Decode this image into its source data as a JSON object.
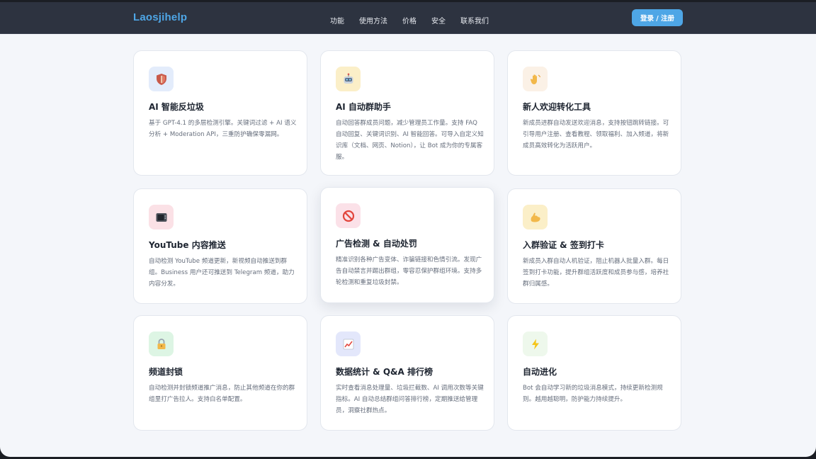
{
  "header": {
    "brand": "Laosjihelp",
    "nav": [
      "功能",
      "使用方法",
      "价格",
      "安全",
      "联系我们"
    ],
    "login_label": "登录 / 注册"
  },
  "features": [
    {
      "icon": "shield-icon",
      "title": "AI 智能反垃圾",
      "desc": "基于 GPT-4.1 的多层检测引擎。关键词过滤 + AI 语义分析 + Moderation API，三重防护确保零漏网。"
    },
    {
      "icon": "robot-icon",
      "title": "AI 自动群助手",
      "desc": "自动回答群成员问题，减少管理员工作量。支持 FAQ 自动回复、关键词识别、AI 智能回答。可导入自定义知识库（文档、网页、Notion），让 Bot 成为你的专属客服。"
    },
    {
      "icon": "wave-hand-icon",
      "title": "新人欢迎转化工具",
      "desc": "新成员进群自动发送欢迎消息，支持按钮跳转链接。可引导用户注册、查看教程、领取福利、加入频道，将新成员高效转化为活跃用户。"
    },
    {
      "icon": "tv-icon",
      "title": "YouTube 内容推送",
      "desc": "自动检测 YouTube 频道更新，新视频自动推送到群组。Business 用户还可推送到 Telegram 频道，助力内容分发。"
    },
    {
      "icon": "prohibited-icon",
      "title": "广告检测 & 自动处罚",
      "desc": "精准识别各种广告变体、诈骗链接和色情引流。发现广告自动禁言并踢出群组，零容忍保护群组环境。支持多轮检测和重复垃圾封禁。"
    },
    {
      "icon": "muscle-icon",
      "title": "入群验证 & 签到打卡",
      "desc": "新成员入群自动人机验证，阻止机器人批量入群。每日签到打卡功能，提升群组活跃度和成员参与感，培养社群归属感。"
    },
    {
      "icon": "lock-icon",
      "title": "频道封锁",
      "desc": "自动检测并封锁频道推广消息，防止其他频道在你的群组里打广告拉人。支持白名单配置。"
    },
    {
      "icon": "chart-icon",
      "title": "数据统计 & Q&A 排行榜",
      "desc": "实时查看消息处理量、垃圾拦截数、AI 调用次数等关键指标。AI 自动总结群组问答排行榜，定期推送给管理员，洞察社群热点。"
    },
    {
      "icon": "lightning-icon",
      "title": "自动进化",
      "desc": "Bot 会自动学习新的垃圾消息模式，持续更新检测规则。越用越聪明，防护能力持续提升。"
    }
  ]
}
